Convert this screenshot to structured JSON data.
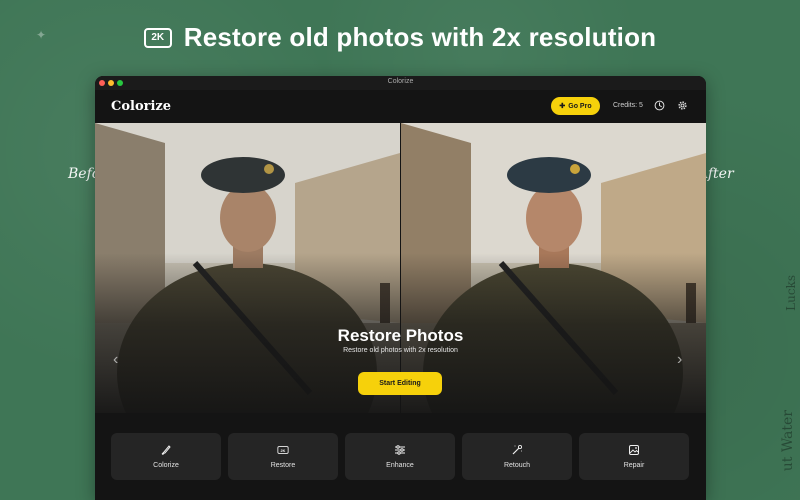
{
  "headline": {
    "badge": "2K",
    "text": "Restore old photos with 2x resolution"
  },
  "side_labels": {
    "before": "Before",
    "after": "After"
  },
  "decor": {
    "text1": "Lucks",
    "text2": "ut Water"
  },
  "window": {
    "title": "Colorize",
    "header": {
      "logo": "Colorize",
      "go_pro": "Go Pro",
      "credits": "Credits: 5",
      "history_icon": "clock-icon",
      "settings_icon": "gear-icon"
    },
    "hero": {
      "title": "Restore Photos",
      "subtitle": "Restore old photos with 2x resolution",
      "cta": "Start Editing"
    },
    "tools": [
      {
        "label": "Colorize",
        "icon": "brush-icon"
      },
      {
        "label": "Restore",
        "icon": "2k-icon"
      },
      {
        "label": "Enhance",
        "icon": "sliders-icon"
      },
      {
        "label": "Retouch",
        "icon": "magic-wand-icon"
      },
      {
        "label": "Repair",
        "icon": "image-repair-icon"
      }
    ]
  },
  "colors": {
    "background": "#3f7656",
    "accent": "#f6d10b",
    "window": "#141414",
    "tile": "#252525"
  }
}
